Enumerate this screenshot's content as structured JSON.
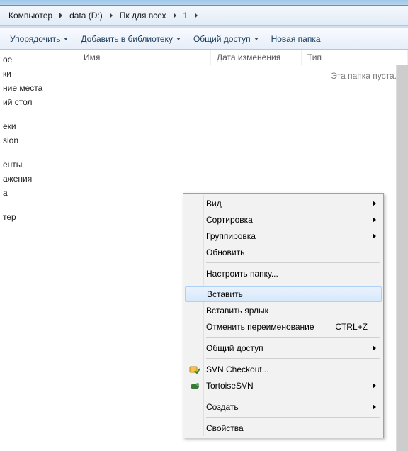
{
  "breadcrumb": [
    {
      "label": "Компьютер"
    },
    {
      "label": "data (D:)"
    },
    {
      "label": "Пк для всех"
    },
    {
      "label": "1"
    }
  ],
  "toolbar": {
    "organize": "Упорядочить",
    "addlib": "Добавить в библиотеку",
    "share": "Общий доступ",
    "newfolder": "Новая папка"
  },
  "sidebar": {
    "items": [
      "ое",
      "ки",
      "ние места",
      "ий стол",
      "",
      "еки",
      "sion",
      "",
      "енты",
      "ажения",
      "а",
      "",
      "тер"
    ]
  },
  "columns": {
    "name": "Имя",
    "date": "Дата изменения",
    "type": "Тип"
  },
  "empty": "Эта папка пуста.",
  "ctx": {
    "view": "Вид",
    "sort": "Сортировка",
    "group": "Группировка",
    "refresh": "Обновить",
    "customize": "Настроить папку...",
    "paste": "Вставить",
    "pastelink": "Вставить ярлык",
    "undo": "Отменить переименование",
    "undo_sc": "CTRL+Z",
    "share": "Общий доступ",
    "svn": "SVN Checkout...",
    "tsvn": "TortoiseSVN",
    "new": "Создать",
    "props": "Свойства"
  }
}
